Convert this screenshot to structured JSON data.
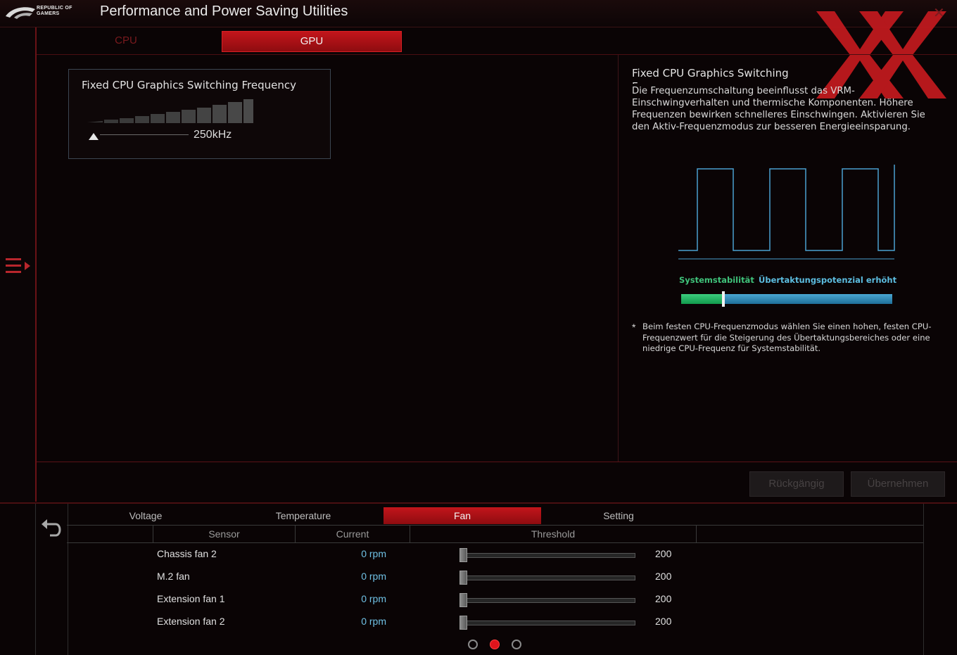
{
  "window": {
    "title": "Performance and Power Saving Utilities",
    "brand_line1": "REPUBLIC OF",
    "brand_line2": "GAMERS",
    "close_symbol": "✕"
  },
  "tabs": [
    {
      "label": "CPU",
      "active": false
    },
    {
      "label": "GPU",
      "active": true
    }
  ],
  "freq_card": {
    "title": "Fixed CPU Graphics Switching Frequency",
    "value": "250kHz",
    "level_fraction": 0.0
  },
  "description": {
    "title": "Fixed CPU Graphics Switching Frequency",
    "text": "Die Frequenzumschaltung beeinflusst das VRM-Einschwingverhalten und thermische Komponenten. Höhere Frequenzen bewirken schnelleres Einschwingen. Aktivieren Sie den Aktiv-Frequenzmodus zur besseren Energieeinsparung.",
    "stability_label": "Systemstabilität",
    "overclock_label": "Übertaktungspotenzial erhöht",
    "stability_fraction": 0.2,
    "note_star": "*",
    "note": "Beim festen CPU-Frequenzmodus wählen Sie einen hohen, festen CPU-Frequenzwert für die Steigerung des Übertaktungsbereiches oder eine niedrige CPU-Frequenz für Systemstabilität."
  },
  "actions": {
    "undo": "Rückgängig",
    "apply": "Übernehmen"
  },
  "monitor": {
    "tabs": [
      {
        "label": "Voltage",
        "active": false
      },
      {
        "label": "Temperature",
        "active": false
      },
      {
        "label": "Fan",
        "active": true
      },
      {
        "label": "Setting",
        "active": false
      }
    ],
    "headers": {
      "sensor": "Sensor",
      "current": "Current",
      "threshold": "Threshold"
    },
    "rows": [
      {
        "sensor": "Chassis fan 2",
        "current": "0 rpm",
        "threshold": "200"
      },
      {
        "sensor": "M.2 fan",
        "current": "0 rpm",
        "threshold": "200"
      },
      {
        "sensor": "Extension fan 1",
        "current": "0 rpm",
        "threshold": "200"
      },
      {
        "sensor": "Extension fan 2",
        "current": "0 rpm",
        "threshold": "200"
      }
    ],
    "page_indicator": {
      "pages": 3,
      "current": 2
    }
  },
  "colors": {
    "accent_red": "#c3151b",
    "stability_green": "#3fc27a",
    "overclock_blue": "#5cbde0",
    "wave_blue": "#4aa0d0"
  },
  "icons": {
    "logo": "rog-eye-logo",
    "menu": "menu-expand-icon",
    "back": "back-arrow-icon",
    "close": "close-icon",
    "watermark": "xx-watermark-logo"
  }
}
